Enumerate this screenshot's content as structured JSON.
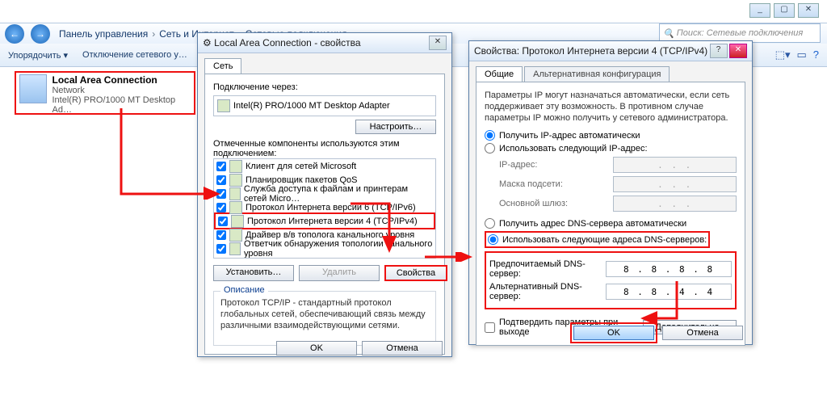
{
  "window_controls": {
    "min": "_",
    "max": "▢",
    "close": "✕"
  },
  "breadcrumb": [
    "Панель управления",
    "Сеть и Интернет",
    "Сетевые подключения"
  ],
  "search_placeholder": "Поиск: Сетевые подключения",
  "toolbar": {
    "organize": "Упорядочить ▾",
    "disable": "Отключение сетевого у…"
  },
  "connection": {
    "name": "Local Area Connection",
    "type": "Network",
    "adapter": "Intel(R) PRO/1000 MT Desktop Ad…"
  },
  "dlg1": {
    "title": "Local Area Connection - свойства",
    "tab": "Сеть",
    "connect_via_label": "Подключение через:",
    "adapter": "Intel(R) PRO/1000 MT Desktop Adapter",
    "config_btn": "Настроить…",
    "components_label": "Отмеченные компоненты используются этим подключением:",
    "items": [
      "Клиент для сетей Microsoft",
      "Планировщик пакетов QoS",
      "Служба доступа к файлам и принтерам сетей Micro…",
      "Протокол Интернета версии 6 (TCP/IPv6)",
      "Протокол Интернета версии 4 (TCP/IPv4)",
      "Драйвер в/в тополога канального уровня",
      "Ответчик обнаружения топологии канального уровня"
    ],
    "install": "Установить…",
    "remove": "Удалить",
    "props": "Свойства",
    "desc_title": "Описание",
    "desc": "Протокол TCP/IP - стандартный протокол глобальных сетей, обеспечивающий связь между различными взаимодействующими сетями.",
    "ok": "OK",
    "cancel": "Отмена"
  },
  "dlg2": {
    "title": "Свойства: Протокол Интернета версии 4 (TCP/IPv4)",
    "tab1": "Общие",
    "tab2": "Альтернативная конфигурация",
    "intro": "Параметры IP могут назначаться автоматически, если сеть поддерживает эту возможность. В противном случае параметры IP можно получить у сетевого администратора.",
    "auto_ip": "Получить IP-адрес автоматически",
    "manual_ip": "Использовать следующий IP-адрес:",
    "ip_label": "IP-адрес:",
    "mask_label": "Маска подсети:",
    "gw_label": "Основной шлюз:",
    "auto_dns": "Получить адрес DNS-сервера автоматически",
    "manual_dns": "Использовать следующие адреса DNS-серверов:",
    "pref_dns_label": "Предпочитаемый DNS-сервер:",
    "alt_dns_label": "Альтернативный DNS-сервер:",
    "pref_dns": "8 . 8 . 8 . 8",
    "alt_dns": "8 . 8 . 4 . 4",
    "validate": "Подтвердить параметры при выходе",
    "advanced": "Дополнительно…",
    "ok": "OK",
    "cancel": "Отмена",
    "dots": ". . ."
  }
}
